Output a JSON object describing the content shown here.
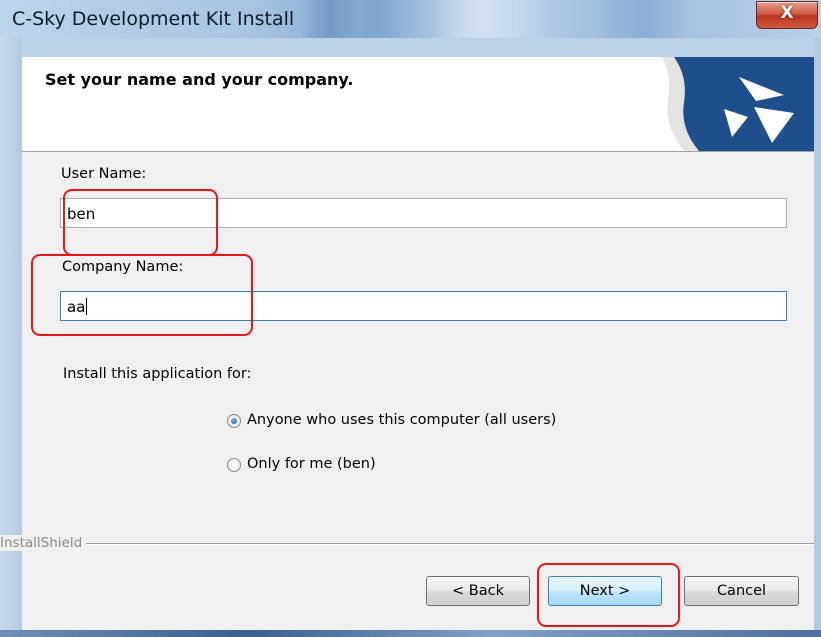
{
  "window": {
    "title": "C-Sky Development Kit Install",
    "close_glyph": "X"
  },
  "header": {
    "title": "Set your name and your company."
  },
  "form": {
    "user_name_label": "User Name:",
    "user_name_value": "ben",
    "company_name_label": "Company Name:",
    "company_name_value": "aa",
    "install_for_label": "Install this application for:",
    "options": [
      {
        "label": "Anyone who uses this computer (all users)",
        "selected": true
      },
      {
        "label": "Only for me (ben)",
        "selected": false
      }
    ]
  },
  "footer": {
    "brand": "InstallShield",
    "back_label": "< Back",
    "next_label": "Next >",
    "cancel_label": "Cancel"
  },
  "colors": {
    "annotation_red": "#e8151b",
    "focus_blue": "#3c7fb1",
    "logo_blue": "#1f4e8c"
  },
  "icons": {
    "close": "close-icon",
    "logo": "installshield-logo-icon",
    "radio": "radio-button-icon"
  }
}
